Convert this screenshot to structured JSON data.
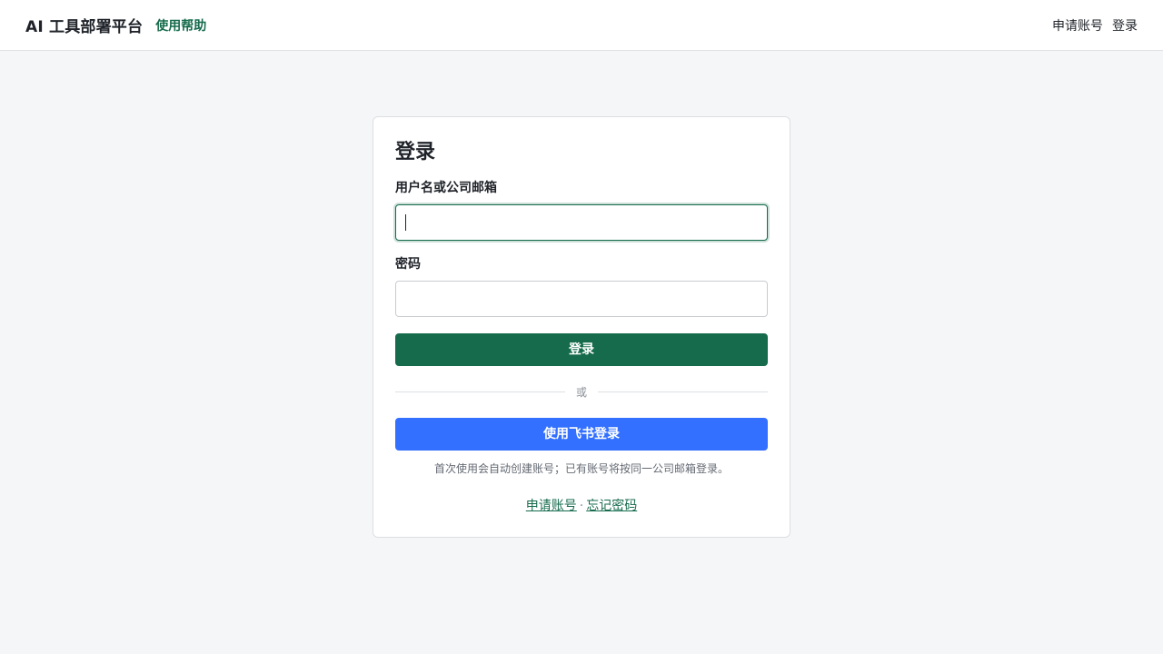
{
  "header": {
    "brand": "AI 工具部署平台",
    "help_link": "使用帮助",
    "apply_link": "申请账号",
    "login_link": "登录"
  },
  "login_card": {
    "title": "登录",
    "username": {
      "label": "用户名或公司邮箱",
      "value": "",
      "placeholder": ""
    },
    "password": {
      "label": "密码",
      "value": "",
      "placeholder": ""
    },
    "submit_label": "登录",
    "divider_text": "或",
    "feishu_label": "使用飞书登录",
    "hint": "首次使用会自动创建账号；已有账号将按同一公司邮箱登录。",
    "footer": {
      "apply_link": "申请账号",
      "separator": "·",
      "forgot_link": "忘记密码"
    }
  },
  "colors": {
    "primary_green": "#166b4c",
    "feishu_blue": "#3370ff",
    "page_background": "#f5f6f8"
  }
}
